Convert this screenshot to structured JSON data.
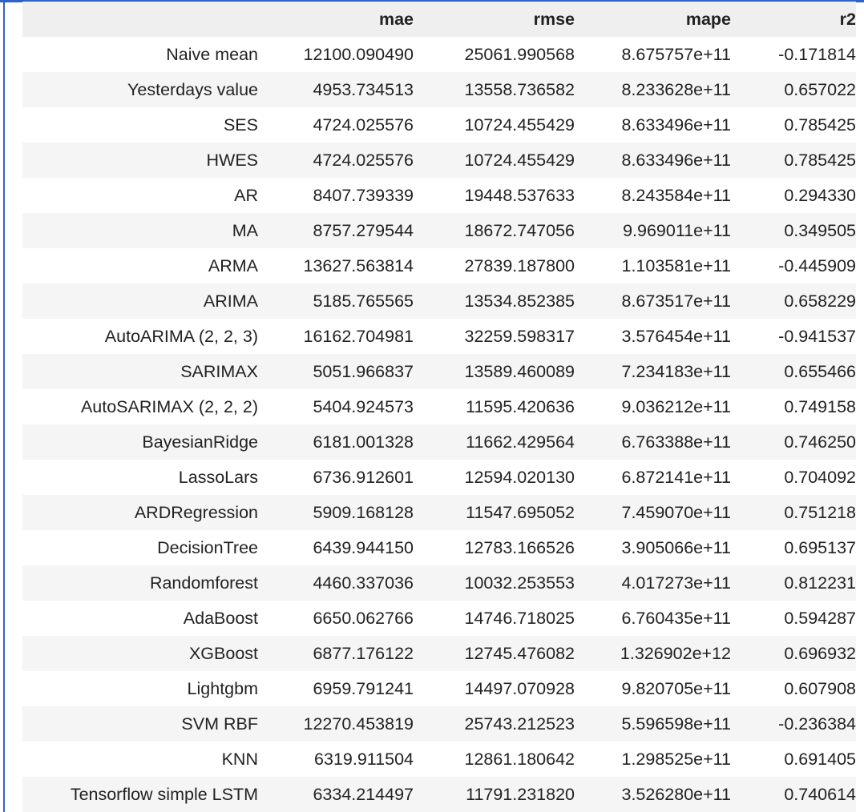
{
  "table": {
    "columns": [
      "",
      "mae",
      "rmse",
      "mape",
      "r2"
    ],
    "rows": [
      [
        "Naive mean",
        "12100.090490",
        "25061.990568",
        "8.675757e+11",
        "-0.171814"
      ],
      [
        "Yesterdays value",
        "4953.734513",
        "13558.736582",
        "8.233628e+11",
        "0.657022"
      ],
      [
        "SES",
        "4724.025576",
        "10724.455429",
        "8.633496e+11",
        "0.785425"
      ],
      [
        "HWES",
        "4724.025576",
        "10724.455429",
        "8.633496e+11",
        "0.785425"
      ],
      [
        "AR",
        "8407.739339",
        "19448.537633",
        "8.243584e+11",
        "0.294330"
      ],
      [
        "MA",
        "8757.279544",
        "18672.747056",
        "9.969011e+11",
        "0.349505"
      ],
      [
        "ARMA",
        "13627.563814",
        "27839.187800",
        "1.103581e+11",
        "-0.445909"
      ],
      [
        "ARIMA",
        "5185.765565",
        "13534.852385",
        "8.673517e+11",
        "0.658229"
      ],
      [
        "AutoARIMA (2, 2, 3)",
        "16162.704981",
        "32259.598317",
        "3.576454e+11",
        "-0.941537"
      ],
      [
        "SARIMAX",
        "5051.966837",
        "13589.460089",
        "7.234183e+11",
        "0.655466"
      ],
      [
        "AutoSARIMAX (2, 2, 2)",
        "5404.924573",
        "11595.420636",
        "9.036212e+11",
        "0.749158"
      ],
      [
        "BayesianRidge",
        "6181.001328",
        "11662.429564",
        "6.763388e+11",
        "0.746250"
      ],
      [
        "LassoLars",
        "6736.912601",
        "12594.020130",
        "6.872141e+11",
        "0.704092"
      ],
      [
        "ARDRegression",
        "5909.168128",
        "11547.695052",
        "7.459070e+11",
        "0.751218"
      ],
      [
        "DecisionTree",
        "6439.944150",
        "12783.166526",
        "3.905066e+11",
        "0.695137"
      ],
      [
        "Randomforest",
        "4460.337036",
        "10032.253553",
        "4.017273e+11",
        "0.812231"
      ],
      [
        "AdaBoost",
        "6650.062766",
        "14746.718025",
        "6.760435e+11",
        "0.594287"
      ],
      [
        "XGBoost",
        "6877.176122",
        "12745.476082",
        "1.326902e+12",
        "0.696932"
      ],
      [
        "Lightgbm",
        "6959.791241",
        "14497.070928",
        "9.820705e+11",
        "0.607908"
      ],
      [
        "SVM RBF",
        "12270.453819",
        "25743.212523",
        "5.596598e+11",
        "-0.236384"
      ],
      [
        "KNN",
        "6319.911504",
        "12861.180642",
        "1.298525e+11",
        "0.691405"
      ],
      [
        "Tensorflow simple LSTM",
        "6334.214497",
        "11791.231820",
        "3.526280e+11",
        "0.740614"
      ]
    ]
  }
}
